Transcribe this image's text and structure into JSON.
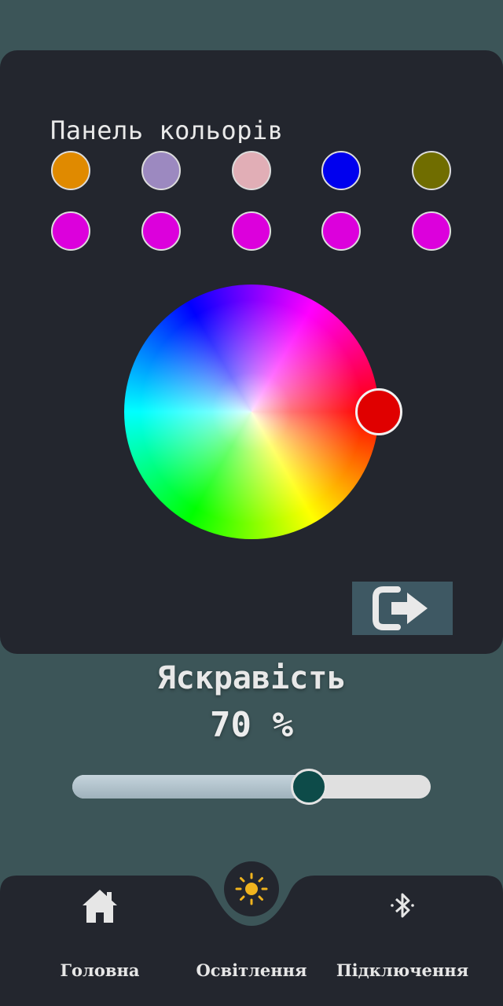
{
  "palette": {
    "title": "Панель кольорів",
    "swatches": [
      "#e08a00",
      "#9c89c0",
      "#e1aeb6",
      "#0000ee",
      "#706d00",
      "#dc00dc",
      "#dc00dc",
      "#dc00dc",
      "#dc00dc",
      "#dc00dc"
    ]
  },
  "color_wheel": {
    "selected_color": "#e00000"
  },
  "apply_button": {
    "icon": "sign-out-arrow-icon"
  },
  "brightness": {
    "label": "Яскравість",
    "value_text": "70 %",
    "value": 0.66
  },
  "nav": {
    "items": [
      {
        "label": "Головна",
        "icon": "home-icon"
      },
      {
        "label": "Освітлення",
        "icon": "sun-icon",
        "active": true,
        "accent": "#f0b41e"
      },
      {
        "label": "Підключення",
        "icon": "bluetooth-icon"
      }
    ]
  }
}
